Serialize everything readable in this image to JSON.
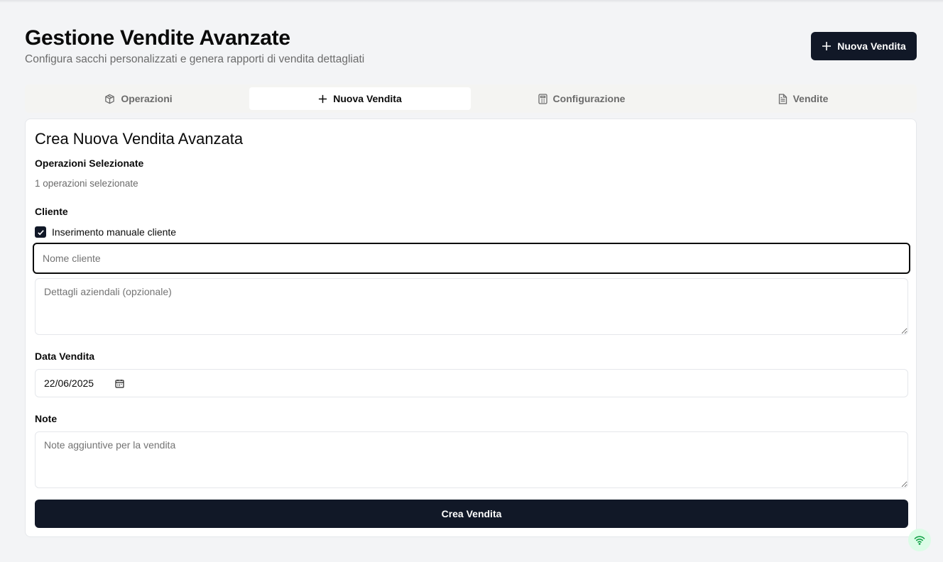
{
  "header": {
    "title": "Gestione Vendite Avanzate",
    "subtitle": "Configura sacchi personalizzati e genera rapporti di vendita dettagliati",
    "new_sale_button": "Nuova Vendita"
  },
  "tabs": [
    {
      "label": "Operazioni",
      "icon": "package-icon"
    },
    {
      "label": "Nuova Vendita",
      "icon": "plus-icon",
      "active": true
    },
    {
      "label": "Configurazione",
      "icon": "calculator-icon"
    },
    {
      "label": "Vendite",
      "icon": "file-text-icon"
    }
  ],
  "form": {
    "title": "Crea Nuova Vendita Avanzata",
    "operations_label": "Operazioni Selezionate",
    "operations_count": "1 operazioni selezionate",
    "client_label": "Cliente",
    "manual_checkbox": "Inserimento manuale cliente",
    "client_name_placeholder": "Nome cliente",
    "company_details_placeholder": "Dettagli aziendali (opzionale)",
    "date_label": "Data Vendita",
    "date_value": "22/06/2025",
    "notes_label": "Note",
    "notes_placeholder": "Note aggiuntive per la vendita",
    "submit": "Crea Vendita"
  },
  "colors": {
    "primary": "#111827",
    "status_ok": "#16a34a"
  }
}
